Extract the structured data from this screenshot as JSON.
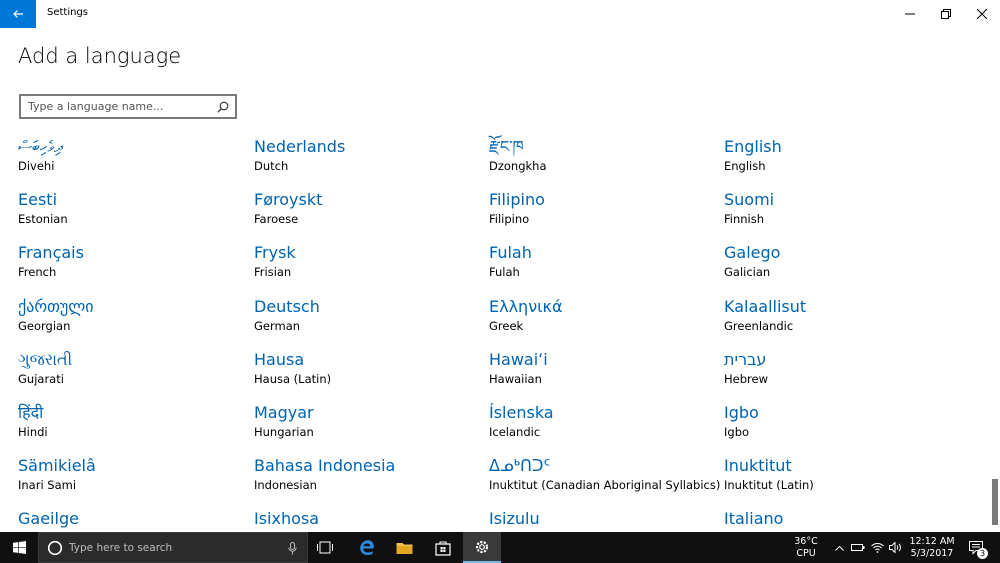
{
  "window": {
    "title": "Settings",
    "back_icon": "back-arrow-icon",
    "minimize_icon": "minimize-icon",
    "restore_icon": "restore-icon",
    "close_icon": "close-icon"
  },
  "page": {
    "title": "Add a language",
    "search_placeholder": "Type a language name...",
    "search_icon": "search-icon"
  },
  "languages": [
    {
      "native": "ދިވެހިބަސް",
      "english": "Divehi"
    },
    {
      "native": "Nederlands",
      "english": "Dutch"
    },
    {
      "native": "རྫོང་ཁ",
      "english": "Dzongkha"
    },
    {
      "native": "English",
      "english": "English"
    },
    {
      "native": "Eesti",
      "english": "Estonian"
    },
    {
      "native": "Føroyskt",
      "english": "Faroese"
    },
    {
      "native": "Filipino",
      "english": "Filipino"
    },
    {
      "native": "Suomi",
      "english": "Finnish"
    },
    {
      "native": "Français",
      "english": "French"
    },
    {
      "native": "Frysk",
      "english": "Frisian"
    },
    {
      "native": "Fulah",
      "english": "Fulah"
    },
    {
      "native": "Galego",
      "english": "Galician"
    },
    {
      "native": "ქართული",
      "english": "Georgian"
    },
    {
      "native": "Deutsch",
      "english": "German"
    },
    {
      "native": "Ελληνικά",
      "english": "Greek"
    },
    {
      "native": "Kalaallisut",
      "english": "Greenlandic"
    },
    {
      "native": "ગુજરાતી",
      "english": "Gujarati"
    },
    {
      "native": "Hausa",
      "english": "Hausa (Latin)"
    },
    {
      "native": "Hawaiʻi",
      "english": "Hawaiian"
    },
    {
      "native": "עברית",
      "english": "Hebrew"
    },
    {
      "native": "हिंदी",
      "english": "Hindi"
    },
    {
      "native": "Magyar",
      "english": "Hungarian"
    },
    {
      "native": "Íslenska",
      "english": "Icelandic"
    },
    {
      "native": "Igbo",
      "english": "Igbo"
    },
    {
      "native": "Sämikielâ",
      "english": "Inari Sami"
    },
    {
      "native": "Bahasa Indonesia",
      "english": "Indonesian"
    },
    {
      "native": "ᐃᓄᒃᑎᑐᑦ",
      "english": "Inuktitut (Canadian Aboriginal Syllabics)"
    },
    {
      "native": "Inuktitut",
      "english": "Inuktitut (Latin)"
    },
    {
      "native": "Gaeilge",
      "english": ""
    },
    {
      "native": "Isixhosa",
      "english": ""
    },
    {
      "native": "Isizulu",
      "english": ""
    },
    {
      "native": "Italiano",
      "english": ""
    }
  ],
  "taskbar": {
    "start_icon": "windows-start-icon",
    "search_placeholder": "Type here to search",
    "mic_icon": "microphone-icon",
    "apps": [
      {
        "name": "task-view-icon"
      },
      {
        "name": "edge-icon"
      },
      {
        "name": "file-explorer-icon"
      },
      {
        "name": "store-icon"
      },
      {
        "name": "settings-gear-icon"
      }
    ],
    "weather_temp": "36°C",
    "weather_label": "CPU",
    "time": "12:12 AM",
    "date": "5/3/2017",
    "notification_count": "3"
  }
}
